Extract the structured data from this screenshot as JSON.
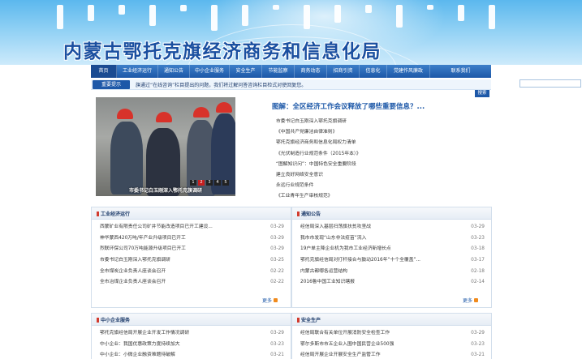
{
  "header": {
    "title": "内蒙古鄂托克旗经济商务和信息化局"
  },
  "nav": {
    "items": [
      {
        "label": "首页"
      },
      {
        "label": "工业经济运行"
      },
      {
        "label": "通知公告"
      },
      {
        "label": "中小企业服务"
      },
      {
        "label": "安全生产"
      },
      {
        "label": "节能监察"
      },
      {
        "label": "商务动态"
      },
      {
        "label": "招商引资"
      },
      {
        "label": "信息化"
      },
      {
        "label": "党建作风廉政"
      },
      {
        "label": "联系我们"
      }
    ]
  },
  "notice": {
    "label": "重要提示",
    "text": "旗通过“在线咨询”栏目提出的问题，我们将过解问答咨询栏目检式对使回复您。"
  },
  "search": {
    "placeholder": "",
    "button_label": "搜索"
  },
  "feature": {
    "caption": "市委书记白玉刚深入鄂托克旗调研",
    "pages": [
      "1",
      "2",
      "3",
      "4",
      "5"
    ],
    "active_page": "2",
    "headline": "图解：全区经济工作会议释放了哪些重要信息？...",
    "items": [
      "市委书记白玉刚深入鄂托克旗调研",
      "《中国共产党廉洁自律准则》",
      "鄂托克旗经济商务和信息化局权力清单",
      "《光伏制造行业规范条件（2015年本）》",
      "“图解知识问”：中国特色安全重要阶段",
      "建立良好网络安全意识",
      "永远行业规范条件",
      "《工业青年生产审核规范》"
    ]
  },
  "panels": {
    "industry": {
      "title": "工业经济运行",
      "more": "更多",
      "rows": [
        {
          "text": "西蒙矿业有限责任公司矿井节能改造项目已开工建设...",
          "date": "03-29"
        },
        {
          "text": "神华蒙西420万吨/年产业升级项目已开工",
          "date": "03-29"
        },
        {
          "text": "烈联环保公司70万吨能源升级项目已开工",
          "date": "03-29"
        },
        {
          "text": "市委书记白玉刚深入鄂托克旗调研",
          "date": "03-25"
        },
        {
          "text": "全市煤炭企业负责人座谈会召开",
          "date": "02-22"
        },
        {
          "text": "全市冶煤企业负责人座谈会召开",
          "date": "02-22"
        }
      ]
    },
    "notices": {
      "title": "通知公告",
      "more": "更多",
      "rows": [
        {
          "text": "经信局深入基层扫荡旗扶贫攻坚战",
          "date": "03-29"
        },
        {
          "text": "我市市发现“山东非法疫苗”流入",
          "date": "03-23"
        },
        {
          "text": "19户单主降企业机为我市工业经济新增长点",
          "date": "03-18"
        },
        {
          "text": "鄂托克旗经信局对打杆接合与鼓动2016年“十个全覆盖”...",
          "date": "03-17"
        },
        {
          "text": "内蒙古都哪各运营结构",
          "date": "02-18"
        },
        {
          "text": "2016鲁中国工业知识瞎报",
          "date": "02-14"
        }
      ]
    },
    "sme": {
      "title": "中小企业服务",
      "rows": [
        {
          "text": "鄂托克旗经信局开展企业开发工作情况调研",
          "date": "03-29"
        },
        {
          "text": "中小企业：我国优惠政策力度持续加大",
          "date": "03-23"
        },
        {
          "text": "中小企业：小微企业融资难题待破解",
          "date": "03-21"
        }
      ]
    },
    "safety": {
      "title": "安全生产",
      "rows": [
        {
          "text": "经信局联合有关单位开展消防安全检查工作",
          "date": "03-29"
        },
        {
          "text": "鄂尔多斯市市五企业入围中国民营企业500强",
          "date": "03-23"
        },
        {
          "text": "经信局开展企业开展安全生产监管工作",
          "date": "03-21"
        }
      ]
    }
  }
}
